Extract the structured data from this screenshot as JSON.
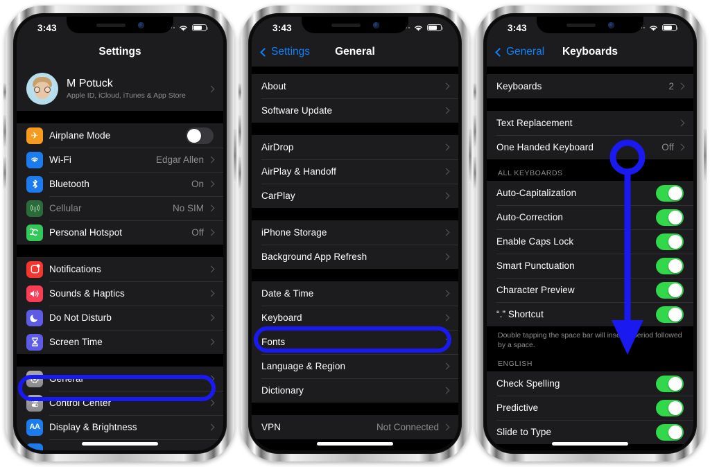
{
  "status_bar": {
    "time": "3:43",
    "wifi_icon": "wifi-icon",
    "battery_icon": "battery-icon",
    "signal_icon": "signal-dots-icon"
  },
  "phone1": {
    "nav": {
      "title": "Settings"
    },
    "profile": {
      "name": "M Potuck",
      "subtitle": "Apple ID, iCloud, iTunes & App Store",
      "avatar_icon": "memoji-avatar"
    },
    "group_connectivity": [
      {
        "label": "Airplane Mode",
        "icon": "airplane-icon",
        "icon_color": "#f59b1d",
        "control": "toggle",
        "on": false
      },
      {
        "label": "Wi-Fi",
        "icon": "wifi-icon",
        "icon_color": "#1c7ced",
        "value": "Edgar Allen"
      },
      {
        "label": "Bluetooth",
        "icon": "bluetooth-icon",
        "icon_color": "#1c7ced",
        "value": "On"
      },
      {
        "label": "Cellular",
        "icon": "cellular-icon",
        "icon_color": "#2b6b39",
        "value": "No SIM",
        "dim": true
      },
      {
        "label": "Personal Hotspot",
        "icon": "hotspot-icon",
        "icon_color": "#34c759",
        "value": "Off"
      }
    ],
    "group_alerts": [
      {
        "label": "Notifications",
        "icon": "notifications-icon",
        "icon_color": "#f5352e"
      },
      {
        "label": "Sounds & Haptics",
        "icon": "sounds-icon",
        "icon_color": "#f93d54"
      },
      {
        "label": "Do Not Disturb",
        "icon": "moon-icon",
        "icon_color": "#5e5ce6"
      },
      {
        "label": "Screen Time",
        "icon": "hourglass-icon",
        "icon_color": "#5e5ce6"
      }
    ],
    "group_system": [
      {
        "label": "General",
        "icon": "gear-icon",
        "icon_color": "#a8a8ab",
        "highlighted": true
      },
      {
        "label": "Control Center",
        "icon": "control-center-icon",
        "icon_color": "#a8a8ab"
      },
      {
        "label": "Display & Brightness",
        "icon": "display-brightness-icon",
        "icon_color": "#1c7ced"
      }
    ]
  },
  "phone2": {
    "nav": {
      "back": "Settings",
      "title": "General"
    },
    "group_a": [
      {
        "label": "About"
      },
      {
        "label": "Software Update"
      }
    ],
    "group_b": [
      {
        "label": "AirDrop"
      },
      {
        "label": "AirPlay & Handoff"
      },
      {
        "label": "CarPlay"
      }
    ],
    "group_c": [
      {
        "label": "iPhone Storage"
      },
      {
        "label": "Background App Refresh"
      }
    ],
    "group_d": [
      {
        "label": "Date & Time"
      },
      {
        "label": "Keyboard",
        "highlighted": true
      },
      {
        "label": "Fonts"
      },
      {
        "label": "Language & Region"
      },
      {
        "label": "Dictionary"
      }
    ],
    "group_e": [
      {
        "label": "VPN",
        "value": "Not Connected"
      }
    ]
  },
  "phone3": {
    "nav": {
      "back": "General",
      "title": "Keyboards"
    },
    "group_keyboards": [
      {
        "label": "Keyboards",
        "value": "2"
      }
    ],
    "group_text": [
      {
        "label": "Text Replacement"
      },
      {
        "label": "One Handed Keyboard",
        "value": "Off"
      }
    ],
    "section_all_keyboards": {
      "header": "ALL KEYBOARDS",
      "rows": [
        {
          "label": "Auto-Capitalization",
          "on": true
        },
        {
          "label": "Auto-Correction",
          "on": true
        },
        {
          "label": "Enable Caps Lock",
          "on": true
        },
        {
          "label": "Smart Punctuation",
          "on": true
        },
        {
          "label": "Character Preview",
          "on": true
        },
        {
          "label": "“.” Shortcut",
          "on": true
        }
      ],
      "footer": "Double tapping the space bar will insert a period followed by a space."
    },
    "section_english": {
      "header": "ENGLISH",
      "rows": [
        {
          "label": "Check Spelling",
          "on": true
        },
        {
          "label": "Predictive",
          "on": true
        },
        {
          "label": "Slide to Type",
          "on": true
        }
      ]
    }
  },
  "annotations": {
    "color": "#1a1af0",
    "ring_general": "highlight-ring-general",
    "ring_keyboard": "highlight-ring-keyboard",
    "arrow_all_keyboards": "annotation-arrow-down"
  }
}
